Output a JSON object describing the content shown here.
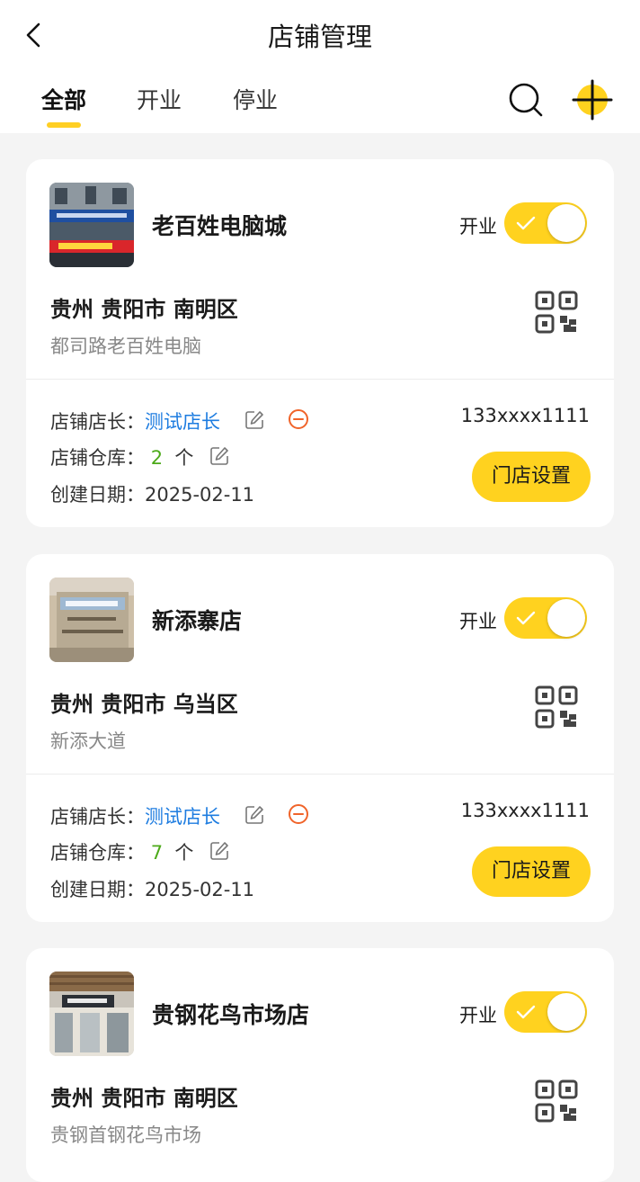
{
  "header": {
    "title": "店铺管理"
  },
  "tabs": [
    {
      "label": "全部",
      "active": true
    },
    {
      "label": "开业",
      "active": false
    },
    {
      "label": "停业",
      "active": false
    }
  ],
  "labels": {
    "status": "开业",
    "manager": "店铺店长：",
    "warehouse": "店铺仓库：",
    "created": "创建日期：",
    "count_unit": "个",
    "settings_button": "门店设置"
  },
  "shops": [
    {
      "name": "老百姓电脑城",
      "region": "贵州 贵阳市 南明区",
      "street": "都司路老百姓电脑",
      "manager": "测试店长",
      "warehouse_count": "2",
      "created_date": "2025-02-11",
      "phone": "133xxxx1111",
      "is_open": true
    },
    {
      "name": "新添寨店",
      "region": "贵州 贵阳市 乌当区",
      "street": "新添大道",
      "manager": "测试店长",
      "warehouse_count": "7",
      "created_date": "2025-02-11",
      "phone": "133xxxx1111",
      "is_open": true
    },
    {
      "name": "贵钢花鸟市场店",
      "region": "贵州 贵阳市 南明区",
      "street": "贵钢首钢花鸟市场",
      "is_open": true
    }
  ],
  "colors": {
    "accent": "#ffd21f",
    "link": "#1d7ce0",
    "count": "#4caa19",
    "remove": "#f0642a"
  },
  "icons": {
    "back": "chevron-left-icon",
    "search": "search-icon",
    "add": "add-icon",
    "qr": "qr-code-icon",
    "edit": "edit-icon",
    "remove": "remove-circle-icon",
    "check": "check-icon"
  }
}
